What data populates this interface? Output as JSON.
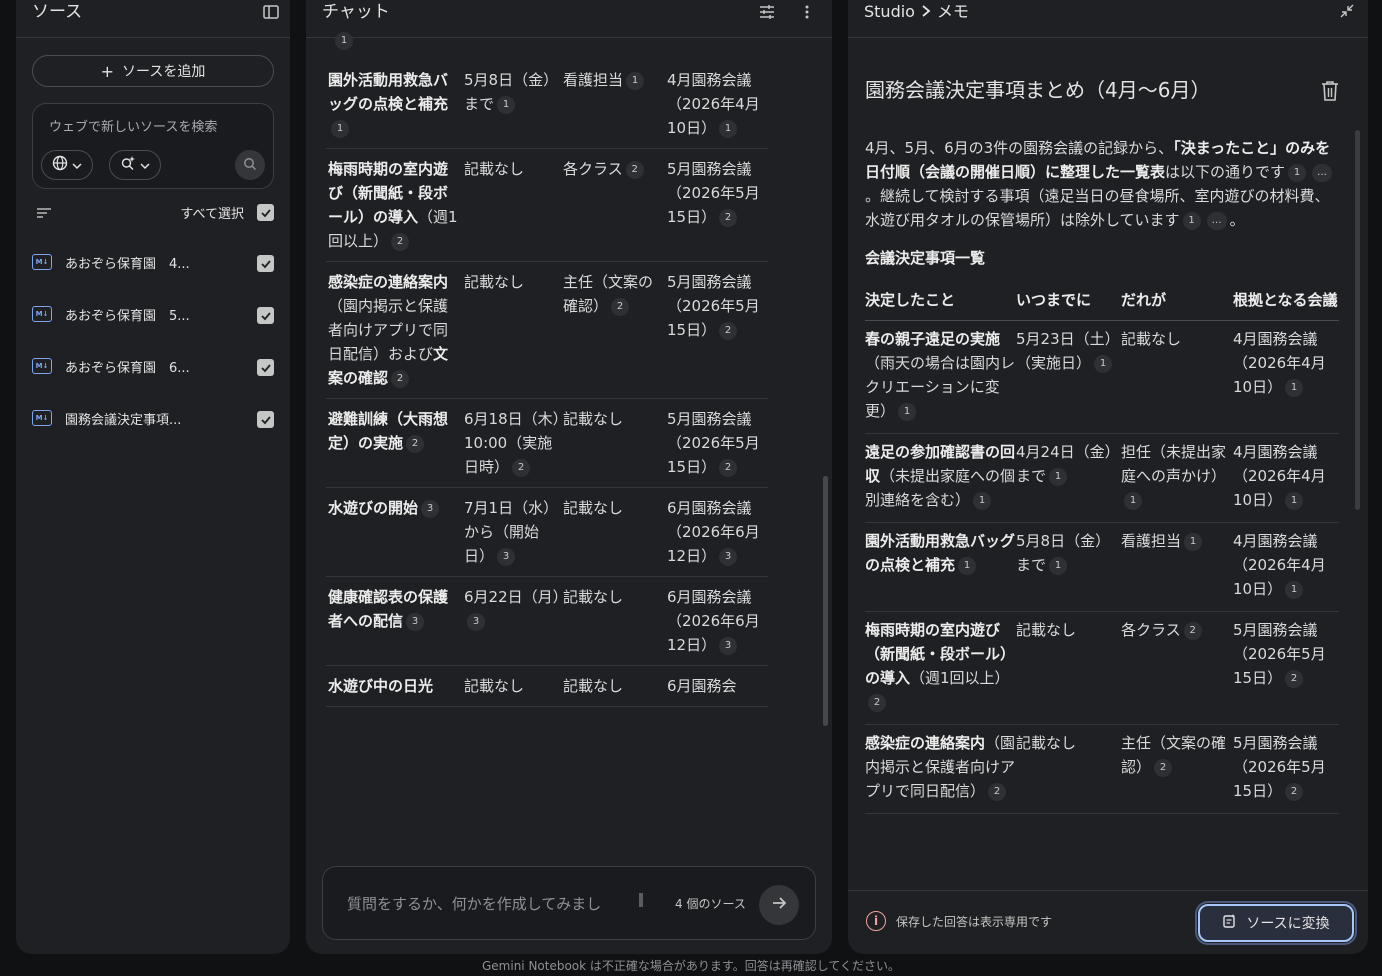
{
  "sources": {
    "title": "ソース",
    "add_label": "ソースを追加",
    "search_placeholder": "ウェブで新しいソースを検索",
    "select_all": "すべて選択",
    "items": [
      {
        "label": "あおぞら保育園　4..."
      },
      {
        "label": "あおぞら保育園　5..."
      },
      {
        "label": "あおぞら保育園　6..."
      },
      {
        "label": "園務会議決定事項..."
      }
    ]
  },
  "chat": {
    "title": "チャット",
    "top_cite_left": "1",
    "rows": [
      {
        "what": [
          "<b>園外活動用救急バッグの点検と補充</b>",
          "1"
        ],
        "when": [
          "5月8日（金）まで",
          "1"
        ],
        "who": [
          "看護担当",
          "1"
        ],
        "meeting": [
          "4月園務会議（2026年4月10日）",
          "1"
        ]
      },
      {
        "what": [
          "<b>梅雨時期の室内遊び（新聞紙・段ボール）の導入</b>（週1回以上）",
          "2"
        ],
        "when": [
          "記載なし",
          ""
        ],
        "who": [
          "各クラス",
          "2"
        ],
        "meeting": [
          "5月園務会議（2026年5月15日）",
          "2"
        ]
      },
      {
        "what": [
          "<b>感染症の連絡案内</b>（園内掲示と保護者向けアプリで同日配信）および<b>文案の確認</b>",
          "2"
        ],
        "when": [
          "記載なし",
          ""
        ],
        "who": [
          "主任（文案の確認）",
          "2"
        ],
        "meeting": [
          "5月園務会議（2026年5月15日）",
          "2"
        ]
      },
      {
        "what": [
          "<b>避難訓練（大雨想定）の実施</b>",
          "2"
        ],
        "when": [
          "6月18日（木）10:00（実施日時）",
          "2"
        ],
        "who": [
          "記載なし",
          ""
        ],
        "meeting": [
          "5月園務会議（2026年5月15日）",
          "2"
        ]
      },
      {
        "what": [
          "<b>水遊びの開始</b>",
          "3"
        ],
        "when": [
          "7月1日（水）から（開始日）",
          "3"
        ],
        "who": [
          "記載なし",
          ""
        ],
        "meeting": [
          "6月園務会議（2026年6月12日）",
          "3"
        ]
      },
      {
        "what": [
          "<b>健康確認表の保護者への配信</b>",
          "3"
        ],
        "when": [
          "6月22日（月）",
          "3"
        ],
        "who": [
          "記載なし",
          ""
        ],
        "meeting": [
          "6月園務会議（2026年6月12日）",
          "3"
        ]
      },
      {
        "what": [
          "<b>水遊び中の日光</b>",
          ""
        ],
        "when": [
          "記載なし",
          ""
        ],
        "who": [
          "記載なし",
          ""
        ],
        "meeting": [
          "6月園務会",
          ""
        ]
      }
    ],
    "composer_placeholder": "質問をするか、何かを作成してみまし",
    "source_count": "4 個のソース"
  },
  "studio": {
    "breadcrumb_root": "Studio",
    "breadcrumb_leaf": "メモ",
    "note_title": "園務会議決定事項まとめ（4月〜6月）",
    "intro_html": "4月、5月、6月の3件の園務会議の記録から、<b>「決まったこと」のみを日付順（会議の開催日順）に整理した一覧表</b>は以下の通りです<span class=\"cite\">1</span><span class=\"cite\">…</span>。継続して検討する事項（遠足当日の昼食場所、室内遊びの材料費、水遊び用タオルの保管場所）は除外しています<span class=\"cite\">1</span><span class=\"cite\">…</span>。",
    "section_heading": "会議決定事項一覧",
    "table_headers": [
      "決定したこと",
      "いつまでに",
      "だれが",
      "根拠となる会議"
    ],
    "rows": [
      {
        "what": [
          "<b>春の親子遠足の実施</b>（雨天の場合は園内レクリエーションに変更）",
          "1"
        ],
        "when": [
          "5月23日（土）（実施日）",
          "1"
        ],
        "who": [
          "記載なし",
          ""
        ],
        "meeting": [
          "4月園務会議（2026年4月10日）",
          "1"
        ]
      },
      {
        "what": [
          "<b>遠足の参加確認書の回収</b>（未提出家庭への個別連絡を含む）",
          "1"
        ],
        "when": [
          "4月24日（金）まで",
          "1"
        ],
        "who": [
          "担任（未提出家庭への声かけ）",
          "1"
        ],
        "meeting": [
          "4月園務会議（2026年4月10日）",
          "1"
        ]
      },
      {
        "what": [
          "<b>園外活動用救急バッグの点検と補充</b>",
          "1"
        ],
        "when": [
          "5月8日（金）まで",
          "1"
        ],
        "who": [
          "看護担当",
          "1"
        ],
        "meeting": [
          "4月園務会議（2026年4月10日）",
          "1"
        ]
      },
      {
        "what": [
          "<b>梅雨時期の室内遊び（新聞紙・段ボール）の導入</b>（週1回以上）",
          "2"
        ],
        "when": [
          "記載なし",
          ""
        ],
        "who": [
          "各クラス",
          "2"
        ],
        "meeting": [
          "5月園務会議（2026年5月15日）",
          "2"
        ]
      },
      {
        "what": [
          "<b>感染症の連絡案内</b>（園内掲示と保護者向けアプリで同日配信）",
          "2"
        ],
        "when": [
          "記載なし",
          ""
        ],
        "who": [
          "主任（文案の確認）",
          "2"
        ],
        "meeting": [
          "5月園務会議（2026年5月15日）",
          "2"
        ]
      }
    ],
    "footer_info": "保存した回答は表示専用です",
    "convert_label": "ソースに変換"
  },
  "footer_disclaimer": "Gemini Notebook は不正確な場合があります。回答は再確認してください。",
  "colors": {
    "background": "#101112",
    "panel": "#1f2023",
    "accent": "#a8c7fa",
    "source_icon": "#7ea6f0",
    "info": "#f0a39e"
  }
}
